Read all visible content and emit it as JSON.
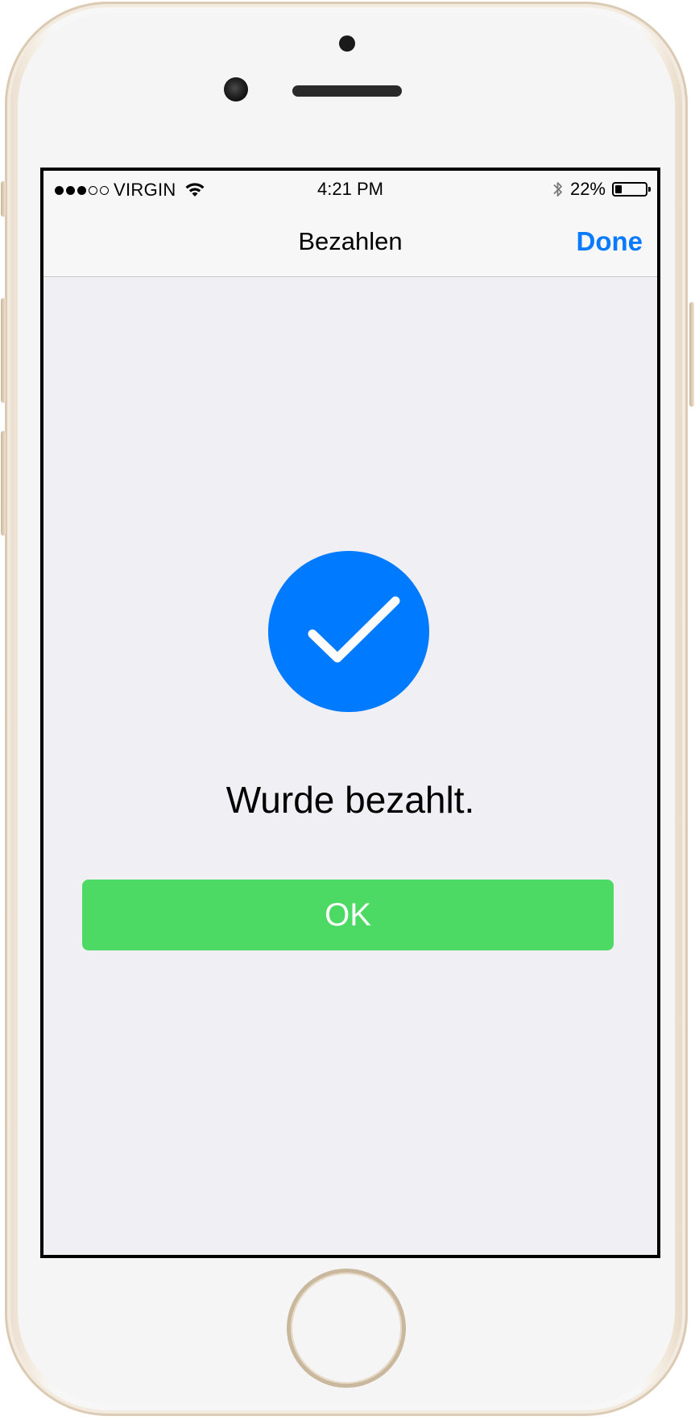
{
  "status_bar": {
    "signal_strength": 3,
    "signal_max": 5,
    "carrier": "VIRGIN",
    "time": "4:21 PM",
    "battery_percent": "22%",
    "battery_level": 0.22,
    "icons": [
      "wifi-icon",
      "bluetooth-icon",
      "battery-icon"
    ]
  },
  "nav": {
    "title": "Bezahlen",
    "done_label": "Done"
  },
  "content": {
    "status_icon": "checkmark-icon",
    "message": "Wurde bezahlt.",
    "ok_label": "OK"
  },
  "colors": {
    "accent": "#007aff",
    "done_text": "#0a7aff",
    "ok_button": "#4cd964",
    "background": "#efeff4",
    "device_gold": "#e6d6c2"
  }
}
